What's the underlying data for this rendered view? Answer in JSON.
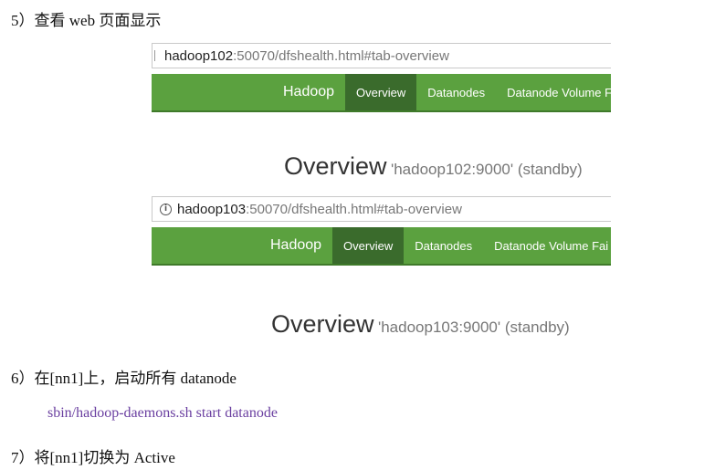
{
  "steps": {
    "step5": "5）查看 web 页面显示",
    "step6": "6）在[nn1]上，启动所有 datanode",
    "step6_cmd": "sbin/hadoop-daemons.sh start datanode",
    "step7": "7）将[nn1]切换为 Active"
  },
  "shot1": {
    "url_host": "hadoop102",
    "url_rest": ":50070/dfshealth.html#tab-overview",
    "nav": {
      "brand": "Hadoop",
      "tabs": [
        "Overview",
        "Datanodes",
        "Datanode Volume F"
      ]
    },
    "overview_title": "Overview",
    "overview_sub": "'hadoop102:9000' (standby)"
  },
  "shot2": {
    "url_icon": "info-icon",
    "url_host": "hadoop103",
    "url_rest": ":50070/dfshealth.html#tab-overview",
    "nav": {
      "brand": "Hadoop",
      "tabs": [
        "Overview",
        "Datanodes",
        "Datanode Volume Fai"
      ]
    },
    "overview_title": "Overview",
    "overview_sub": "'hadoop103:9000' (standby)"
  },
  "colors": {
    "navbar": "#5ba13f",
    "active_tab": "#3a6b2c",
    "command_text": "#6a3fa0"
  }
}
